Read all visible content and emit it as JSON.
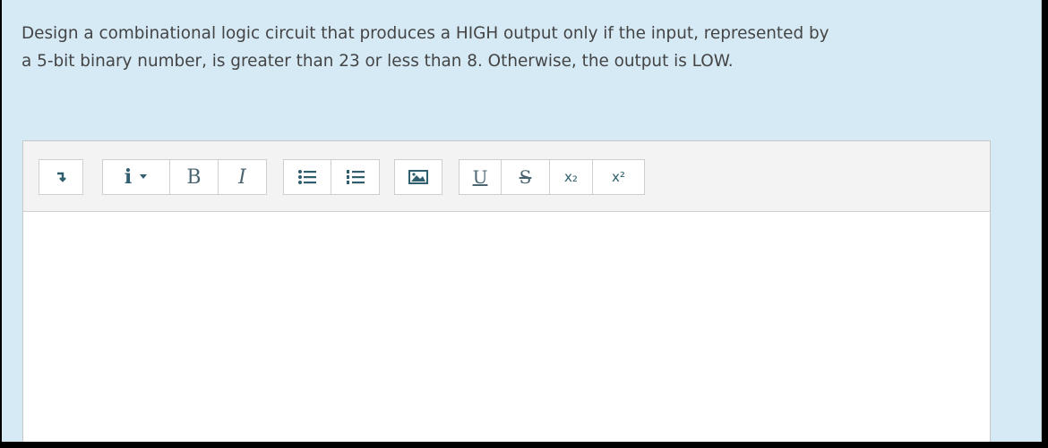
{
  "question": {
    "line1": "Design a combinational logic circuit that produces a HIGH output only if the input, represented by",
    "line2": "a 5-bit binary number, is greater than 23 or less than 8. Otherwise, the output is LOW."
  },
  "toolbar": {
    "buttons": [
      {
        "name": "paragraph-format",
        "icon": "pilcrow-arrow-icon"
      },
      {
        "name": "info-dropdown",
        "label": "i",
        "icon": "caret-down-icon"
      },
      {
        "name": "bold",
        "label": "B"
      },
      {
        "name": "italic",
        "label": "I"
      },
      {
        "name": "bulleted-list",
        "icon": "bullet-list-icon"
      },
      {
        "name": "numbered-list",
        "icon": "numbered-list-icon"
      },
      {
        "name": "insert-image",
        "icon": "image-icon"
      },
      {
        "name": "underline",
        "label": "U"
      },
      {
        "name": "strikethrough",
        "label": "S"
      },
      {
        "name": "subscript",
        "label": "x₂"
      },
      {
        "name": "superscript",
        "label": "x²"
      }
    ]
  },
  "editor": {
    "content": ""
  },
  "colors": {
    "panel": "#d6eaf6",
    "icon": "#2f5f6f",
    "toolbar": "#f3f3f3"
  }
}
